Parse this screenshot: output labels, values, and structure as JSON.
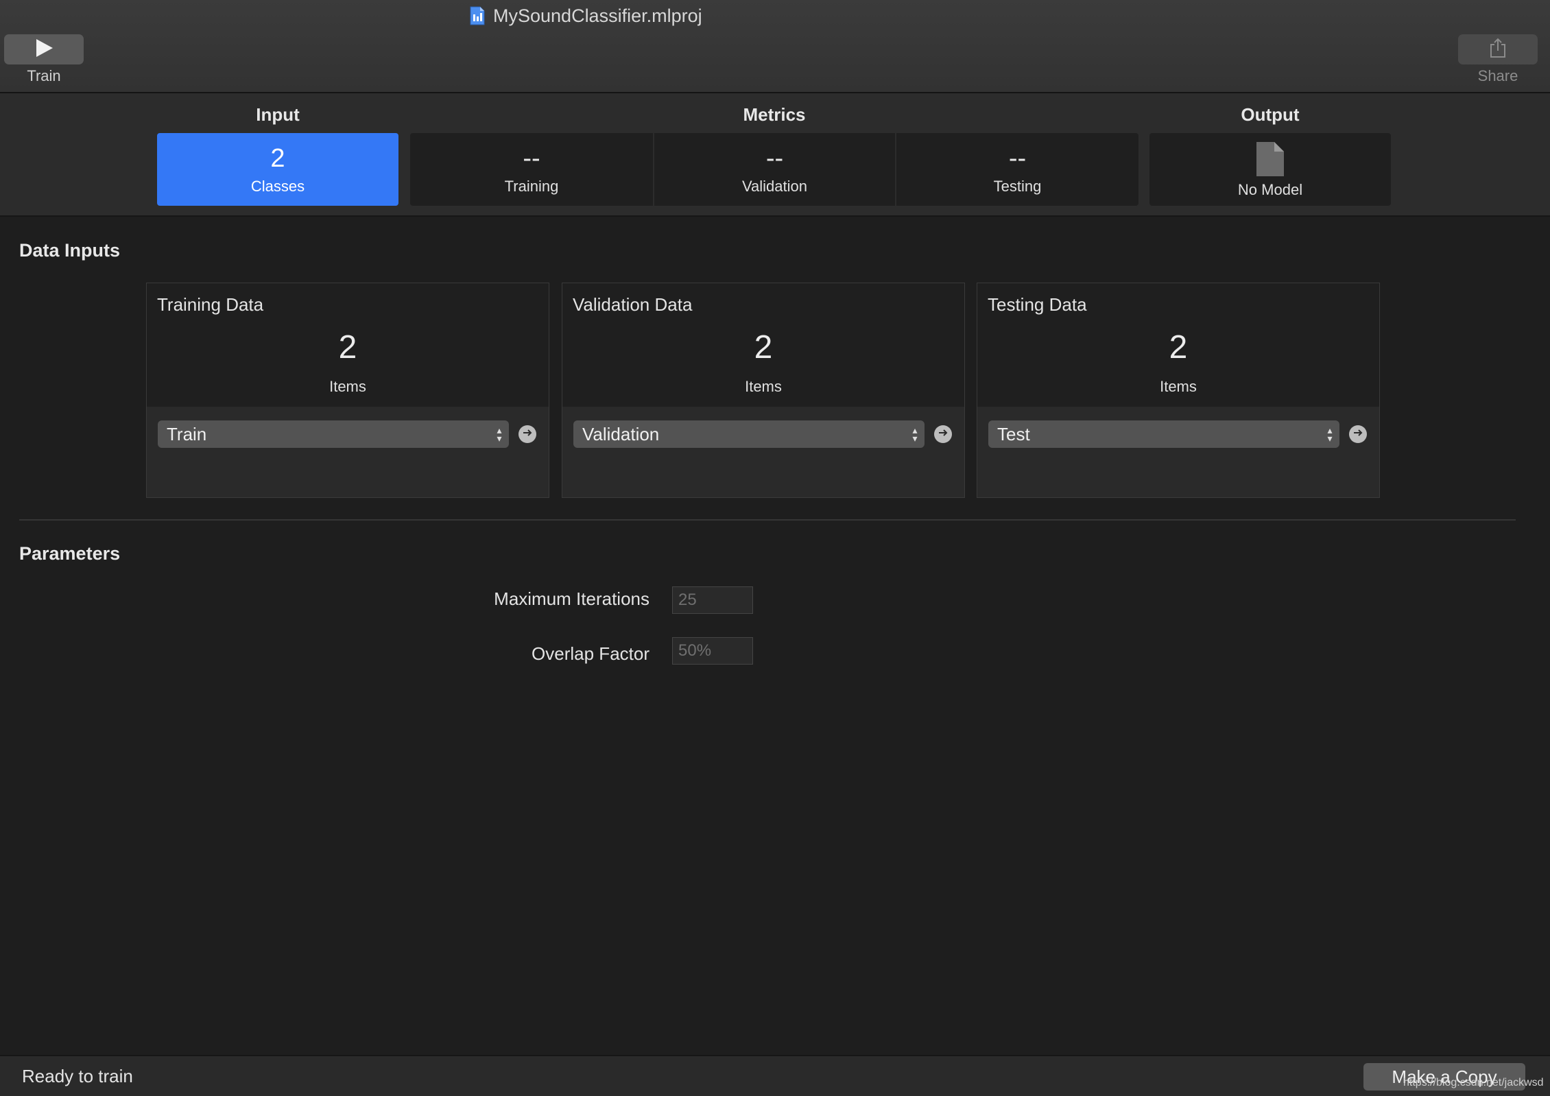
{
  "window": {
    "title": "MySoundClassifier.mlproj"
  },
  "toolbar": {
    "train_label": "Train",
    "share_label": "Share"
  },
  "tabs": {
    "input_header": "Input",
    "metrics_header": "Metrics",
    "output_header": "Output",
    "classes": {
      "value": "2",
      "label": "Classes"
    },
    "training": {
      "value": "--",
      "label": "Training"
    },
    "validation": {
      "value": "--",
      "label": "Validation"
    },
    "testing": {
      "value": "--",
      "label": "Testing"
    },
    "output": {
      "label": "No Model"
    }
  },
  "data_inputs": {
    "title": "Data Inputs",
    "cards": [
      {
        "title": "Training Data",
        "count": "2",
        "unit": "Items",
        "selection": "Train"
      },
      {
        "title": "Validation Data",
        "count": "2",
        "unit": "Items",
        "selection": "Validation"
      },
      {
        "title": "Testing Data",
        "count": "2",
        "unit": "Items",
        "selection": "Test"
      }
    ]
  },
  "parameters": {
    "title": "Parameters",
    "max_iterations": {
      "label": "Maximum Iterations",
      "placeholder": "25"
    },
    "overlap_factor": {
      "label": "Overlap Factor",
      "placeholder": "50%"
    }
  },
  "status": {
    "text": "Ready to train",
    "make_copy_label": "Make a Copy",
    "watermark": "https://blog.csdn.net/jackwsd"
  },
  "colors": {
    "accent": "#3478f6",
    "background": "#1e1e1e"
  }
}
